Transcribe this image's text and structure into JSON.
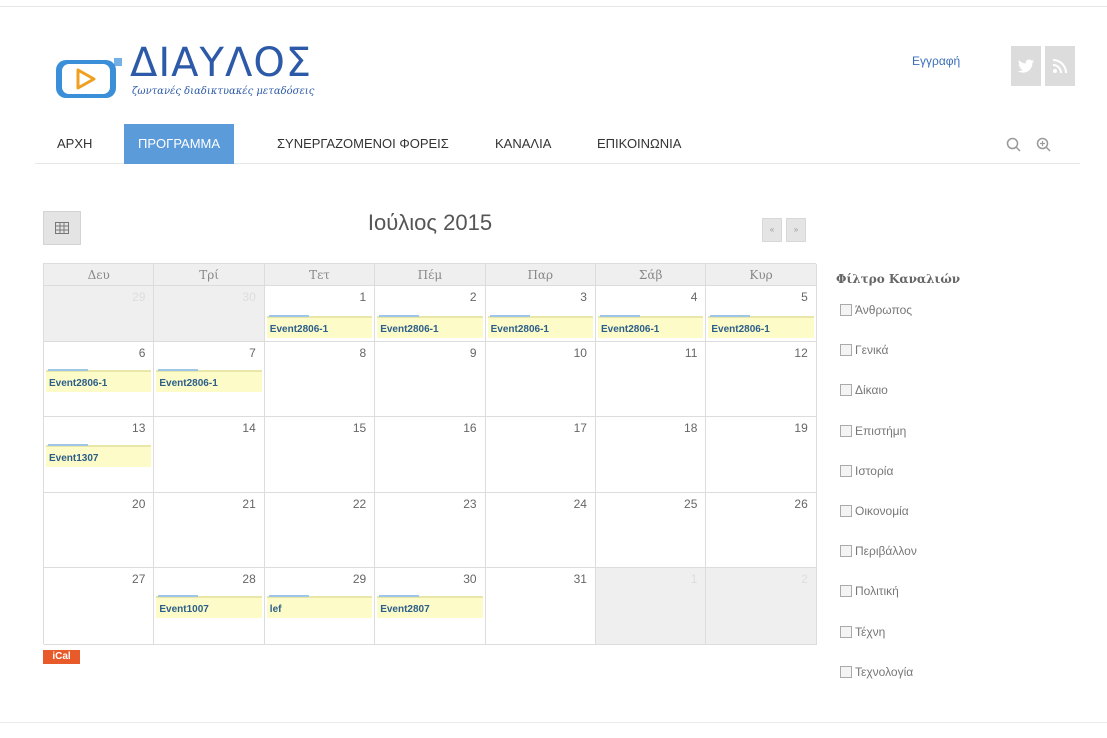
{
  "header": {
    "logo_title": "ΔΙΑΥΛΟΣ",
    "logo_subtitle": "ζωντανές διαδικτυακές μεταδόσεις",
    "register_link": "Εγγραφή",
    "social_icons": [
      "twitter-icon",
      "rss-icon"
    ]
  },
  "nav": {
    "items": [
      {
        "label": "ΑΡΧΗ",
        "active": false
      },
      {
        "label": "ΠΡΟΓΡΑΜΜΑ",
        "active": true
      },
      {
        "label": "ΣΥΝΕΡΓΑΖΟΜΕΝΟΙ ΦΟΡΕΙΣ",
        "active": false
      },
      {
        "label": "ΚΑΝΑΛΙΑ",
        "active": false
      },
      {
        "label": "ΕΠΙΚΟΙΝΩΝΙΑ",
        "active": false
      }
    ],
    "icons": [
      "search-icon",
      "zoom-icon"
    ]
  },
  "calendar": {
    "month_title": "Ιούλιος 2015",
    "prev_label": "«",
    "next_label": "»",
    "weekdays": [
      "Δευ",
      "Τρί",
      "Τετ",
      "Πέμ",
      "Παρ",
      "Σάβ",
      "Κυρ"
    ],
    "weeks": [
      [
        {
          "day": "29",
          "other": true,
          "event": ""
        },
        {
          "day": "30",
          "other": true,
          "event": ""
        },
        {
          "day": "1",
          "other": false,
          "event": "Event2806-1"
        },
        {
          "day": "2",
          "other": false,
          "event": "Event2806-1"
        },
        {
          "day": "3",
          "other": false,
          "event": "Event2806-1"
        },
        {
          "day": "4",
          "other": false,
          "event": "Event2806-1"
        },
        {
          "day": "5",
          "other": false,
          "event": "Event2806-1"
        }
      ],
      [
        {
          "day": "6",
          "other": false,
          "event": "Event2806-1"
        },
        {
          "day": "7",
          "other": false,
          "event": "Event2806-1"
        },
        {
          "day": "8",
          "other": false,
          "event": ""
        },
        {
          "day": "9",
          "other": false,
          "event": ""
        },
        {
          "day": "10",
          "other": false,
          "event": ""
        },
        {
          "day": "11",
          "other": false,
          "event": ""
        },
        {
          "day": "12",
          "other": false,
          "event": ""
        }
      ],
      [
        {
          "day": "13",
          "other": false,
          "event": "Event1307"
        },
        {
          "day": "14",
          "other": false,
          "event": ""
        },
        {
          "day": "15",
          "other": false,
          "event": ""
        },
        {
          "day": "16",
          "other": false,
          "event": ""
        },
        {
          "day": "17",
          "other": false,
          "event": ""
        },
        {
          "day": "18",
          "other": false,
          "event": ""
        },
        {
          "day": "19",
          "other": false,
          "event": ""
        }
      ],
      [
        {
          "day": "20",
          "other": false,
          "event": ""
        },
        {
          "day": "21",
          "other": false,
          "event": ""
        },
        {
          "day": "22",
          "other": false,
          "event": ""
        },
        {
          "day": "23",
          "other": false,
          "event": ""
        },
        {
          "day": "24",
          "other": false,
          "event": ""
        },
        {
          "day": "25",
          "other": false,
          "event": ""
        },
        {
          "day": "26",
          "other": false,
          "event": ""
        }
      ],
      [
        {
          "day": "27",
          "other": false,
          "event": ""
        },
        {
          "day": "28",
          "other": false,
          "event": "Event1007"
        },
        {
          "day": "29",
          "other": false,
          "event": "lef"
        },
        {
          "day": "30",
          "other": false,
          "event": "Event2807"
        },
        {
          "day": "31",
          "other": false,
          "event": ""
        },
        {
          "day": "1",
          "other": true,
          "event": ""
        },
        {
          "day": "2",
          "other": true,
          "event": ""
        }
      ]
    ],
    "ical_label": "iCal"
  },
  "filter": {
    "title": "Φίλτρο Καναλιών",
    "items": [
      "Άνθρωπος",
      "Γενικά",
      "Δίκαιο",
      "Επιστήμη",
      "Ιστορία",
      "Οικονομία",
      "Περιβάλλον",
      "Πολιτική",
      "Τέχνη",
      "Τεχνολογία"
    ]
  },
  "colors": {
    "accent": "#5b9bd9",
    "brand": "#2c5aa8",
    "event_bg": "#fdfbc8",
    "ical": "#e85a2a"
  }
}
